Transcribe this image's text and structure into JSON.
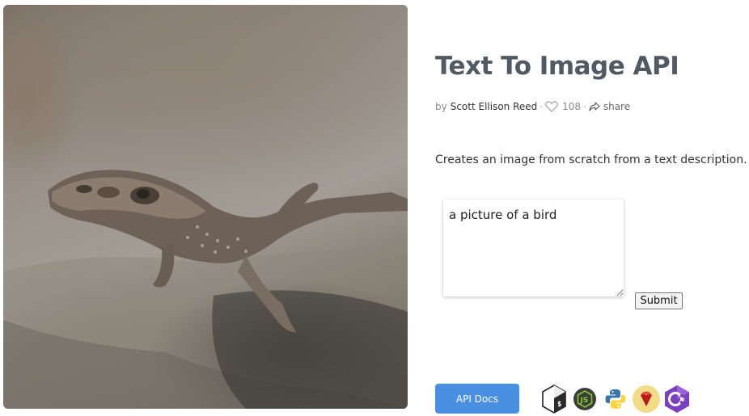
{
  "app": {
    "title": "Text To Image API",
    "by_label": "by",
    "author": "Scott Ellison Reed",
    "separator": "·",
    "likes": "108",
    "share_label": "share",
    "description": "Creates an image from scratch from a text description."
  },
  "form": {
    "prompt_value": "a picture of a bird",
    "submit_label": "Submit"
  },
  "footer": {
    "api_docs_label": "API Docs",
    "language_icons": [
      "shell-icon",
      "nodejs-icon",
      "python-icon",
      "ruby-icon",
      "csharp-icon"
    ]
  },
  "colors": {
    "title": "#505a63",
    "api_button": "#4a90e2",
    "ruby_bg": "#f2dc86",
    "nodejs_bg": "#3c3c3c",
    "csharp_bg": "#7b3fbf"
  },
  "result_image": {
    "subject": "lizard on rock"
  }
}
